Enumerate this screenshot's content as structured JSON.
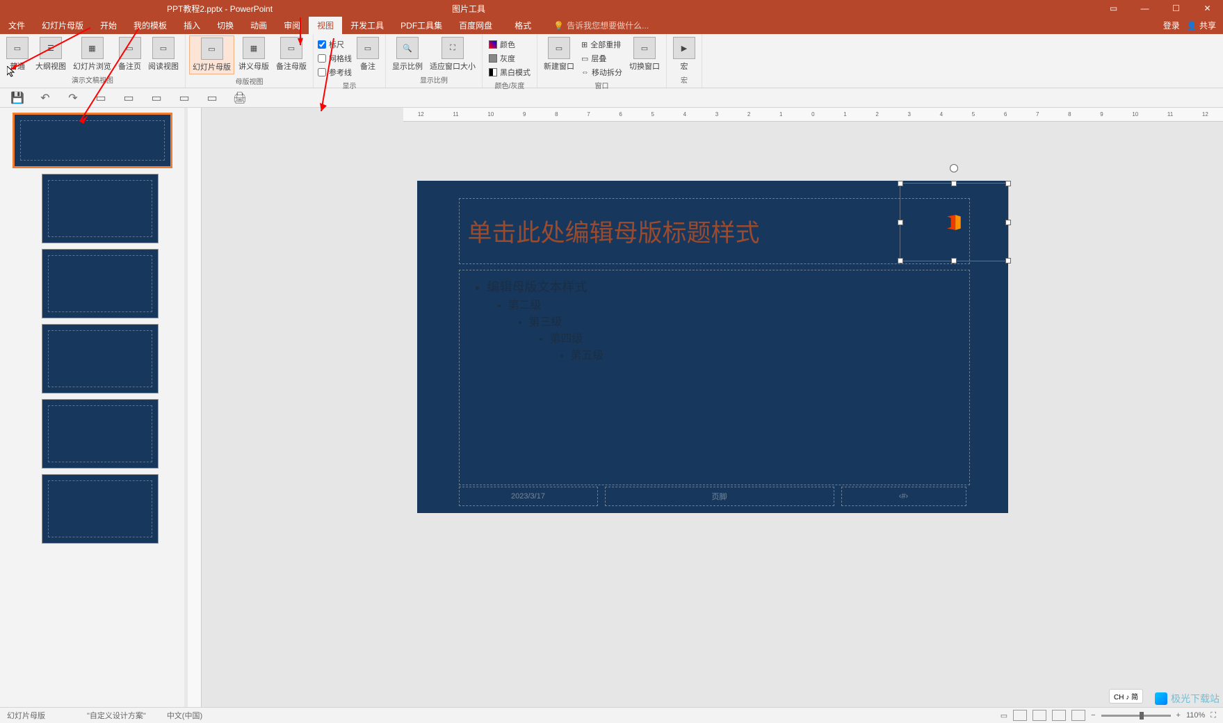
{
  "window": {
    "title": "PPT教程2.pptx - PowerPoint",
    "contextual_tab": "图片工具"
  },
  "tabs": {
    "file": "文件",
    "slide_master_tab": "幻灯片母版",
    "home": "开始",
    "my_templates": "我的模板",
    "insert": "插入",
    "transitions": "切换",
    "animations": "动画",
    "review": "审阅",
    "view": "视图",
    "developer": "开发工具",
    "pdf_tools": "PDF工具集",
    "baidu_netdisk": "百度网盘",
    "format": "格式",
    "tell_me": "告诉我您想要做什么...",
    "login": "登录",
    "share": "共享"
  },
  "ribbon": {
    "presentation_views": {
      "normal": "普通",
      "outline": "大纲视图",
      "slide_sorter": "幻灯片浏览",
      "notes_page": "备注页",
      "reading": "阅读视图",
      "group_label": "演示文稿视图"
    },
    "master_views": {
      "slide_master": "幻灯片母版",
      "handout_master": "讲义母版",
      "notes_master": "备注母版",
      "group_label": "母版视图"
    },
    "show": {
      "ruler": "标尺",
      "gridlines": "网格线",
      "guides": "参考线",
      "notes": "备注",
      "group_label": "显示"
    },
    "zoom": {
      "zoom": "显示比例",
      "fit": "适应窗口大小",
      "group_label": "显示比例"
    },
    "color": {
      "color": "颜色",
      "grayscale": "灰度",
      "bw": "黑白模式",
      "group_label": "颜色/灰度"
    },
    "window": {
      "new": "新建窗口",
      "arrange_all": "全部重排",
      "cascade": "层叠",
      "move_split": "移动拆分",
      "switch": "切换窗口",
      "group_label": "窗口"
    },
    "macros": {
      "macros": "宏",
      "group_label": "宏"
    }
  },
  "slide": {
    "title": "单击此处编辑母版标题样式",
    "content_l1": "编辑母版文本样式",
    "content_l2": "第二级",
    "content_l3": "第三级",
    "content_l4": "第四级",
    "content_l5": "第五级",
    "date": "2023/3/17",
    "footer": "页脚",
    "slide_num": "‹#›"
  },
  "status": {
    "mode": "幻灯片母版",
    "theme": "\"自定义设计方案\"",
    "language": "中文(中国)",
    "zoom": "110%",
    "ime": "CH ♪ 简"
  },
  "ruler": {
    "marks": [
      "12",
      "11",
      "10",
      "9",
      "8",
      "7",
      "6",
      "5",
      "4",
      "3",
      "2",
      "1",
      "0",
      "1",
      "2",
      "3",
      "4",
      "5",
      "6",
      "7",
      "8",
      "9",
      "10",
      "11",
      "12"
    ]
  },
  "watermark": "极光下载站"
}
